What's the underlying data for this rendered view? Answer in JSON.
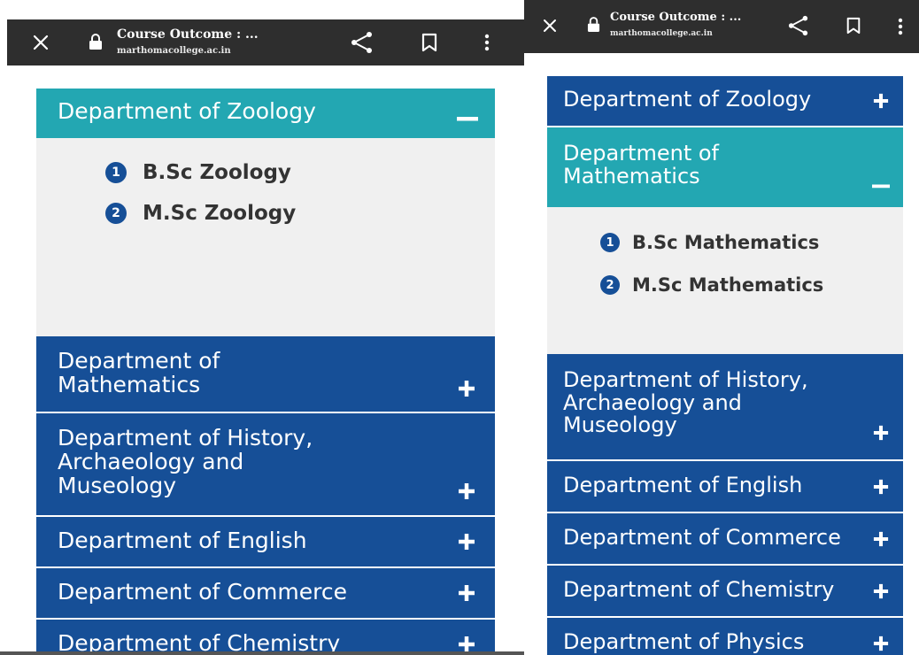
{
  "colors": {
    "toolbar_bg": "#2e2e2e",
    "header_blue": "#164f97",
    "header_teal": "#23a7b2",
    "panel_body": "#f0f0f0",
    "badge_bg": "#164f97",
    "program_text": "#333333"
  },
  "icons": {
    "close": "close-icon",
    "lock": "lock-icon",
    "share": "share-icon",
    "bookmark": "bookmark-icon",
    "menu": "more-vertical-icon",
    "expand": "plus-icon",
    "collapse": "minus-icon"
  },
  "left": {
    "browser": {
      "title": "Course Outcome : ...",
      "url": "marthomacollege.ac.in"
    },
    "accordion": [
      {
        "label_lines": [
          "Department of Zoology"
        ],
        "expanded": true
      },
      {
        "label_lines": [
          "Department of",
          "Mathematics"
        ],
        "expanded": false
      },
      {
        "label_lines": [
          "Department of History,",
          "Archaeology and",
          "Museology"
        ],
        "expanded": false
      },
      {
        "label_lines": [
          "Department of English"
        ],
        "expanded": false
      },
      {
        "label_lines": [
          "Department of Commerce"
        ],
        "expanded": false
      },
      {
        "label_lines": [
          "Department of Chemistry"
        ],
        "expanded": false
      }
    ],
    "programs": [
      {
        "number": "1",
        "label": "B.Sc Zoology"
      },
      {
        "number": "2",
        "label": "M.Sc Zoology"
      }
    ]
  },
  "right": {
    "browser": {
      "title": "Course Outcome : ...",
      "url": "marthomacollege.ac.in"
    },
    "accordion": [
      {
        "label_lines": [
          "Department of Zoology"
        ],
        "expanded": false
      },
      {
        "label_lines": [
          "Department of",
          "Mathematics"
        ],
        "expanded": true
      },
      {
        "label_lines": [
          "Department of History,",
          "Archaeology and",
          "Museology"
        ],
        "expanded": false
      },
      {
        "label_lines": [
          "Department of English"
        ],
        "expanded": false
      },
      {
        "label_lines": [
          "Department of Commerce"
        ],
        "expanded": false
      },
      {
        "label_lines": [
          "Department of Chemistry"
        ],
        "expanded": false
      },
      {
        "label_lines": [
          "Department of Physics"
        ],
        "expanded": false
      }
    ],
    "programs": [
      {
        "number": "1",
        "label": "B.Sc Mathematics"
      },
      {
        "number": "2",
        "label": "M.Sc Mathematics"
      }
    ]
  }
}
